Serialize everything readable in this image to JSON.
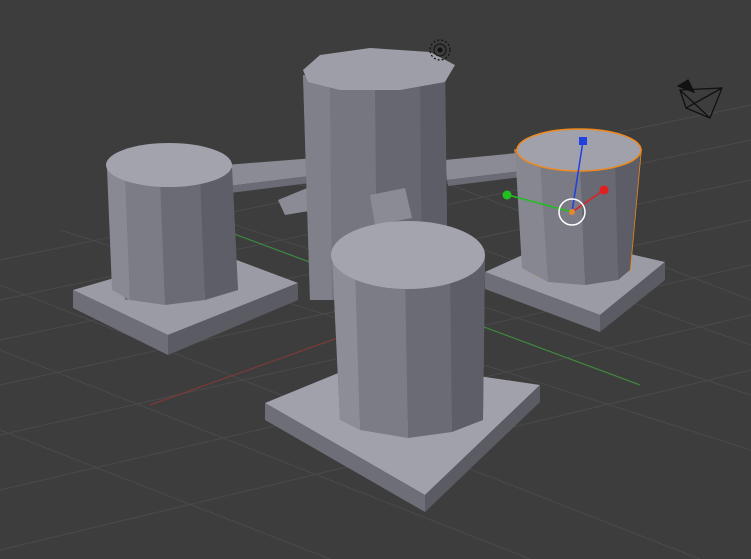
{
  "viewport": {
    "background": "#3d3d3d",
    "grid_color": "#4a4a4a",
    "x_axis_color": "#7a3a3a",
    "y_axis_color": "#3f8a3f"
  },
  "scene": {
    "object_color": "#7d7e88",
    "selected_object_outline": "#f08a1c",
    "objects": [
      {
        "name": "tall-center-cylinder"
      },
      {
        "name": "left-cylinder"
      },
      {
        "name": "front-cylinder"
      },
      {
        "name": "right-cylinder",
        "selected": true
      }
    ]
  },
  "gizmo": {
    "x_color": "#e02020",
    "y_color": "#20c020",
    "z_color": "#2040e0",
    "center_color": "#e08a30"
  },
  "icons": {
    "camera": "camera-icon",
    "light": "lamp-icon",
    "cursor": "3d-cursor-icon"
  }
}
